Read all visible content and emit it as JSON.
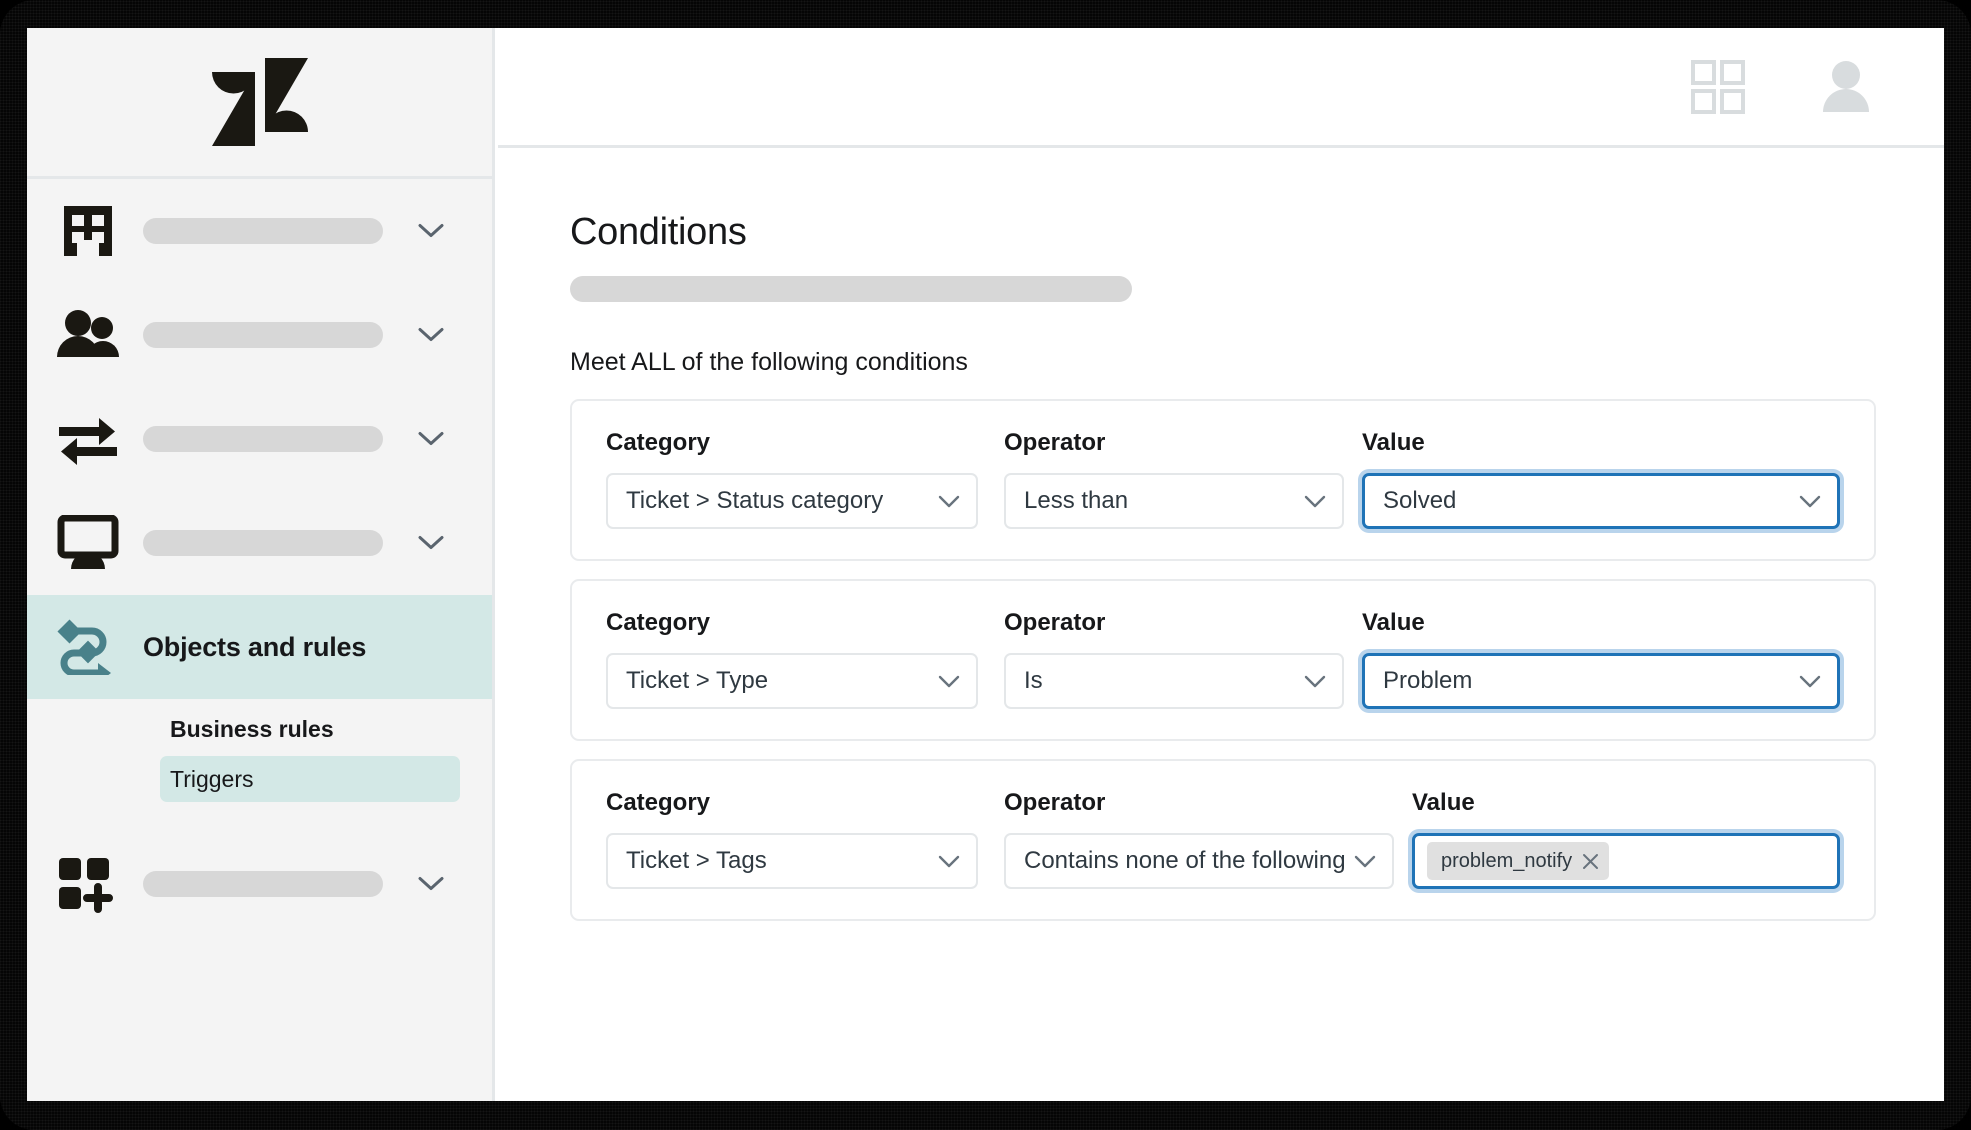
{
  "brand": {
    "logo_name": "zendesk-logo",
    "accent_teal": "#49818a",
    "highlight_teal": "#d3e8e6",
    "focus_blue": "#1f73b7",
    "focus_ring": "#b9d4ec"
  },
  "topbar": {
    "grid_icon": "grid-apps-icon",
    "avatar_icon": "user-avatar-icon"
  },
  "sidebar": {
    "items": [
      {
        "icon": "building-icon",
        "label": "",
        "placeholder": true,
        "chevron": true
      },
      {
        "icon": "people-icon",
        "label": "",
        "placeholder": true,
        "chevron": true
      },
      {
        "icon": "transfer-arrows-icon",
        "label": "",
        "placeholder": true,
        "chevron": true
      },
      {
        "icon": "monitor-icon",
        "label": "",
        "placeholder": true,
        "chevron": true
      },
      {
        "icon": "objects-rules-icon",
        "label": "Objects and rules",
        "placeholder": false,
        "chevron": false,
        "active": true
      },
      {
        "icon": "apps-add-icon",
        "label": "",
        "placeholder": true,
        "chevron": true
      }
    ],
    "subnav": {
      "heading": "Business rules",
      "selected_item": "Triggers"
    }
  },
  "main": {
    "page_title": "Conditions",
    "subtitle_placeholder": true,
    "meet_all_label": "Meet ALL of the following conditions",
    "column_labels": {
      "category": "Category",
      "operator": "Operator",
      "value": "Value"
    },
    "conditions": [
      {
        "category": "Ticket > Status category",
        "operator": "Less than",
        "value": "Solved",
        "value_type": "select",
        "value_focused": true
      },
      {
        "category": "Ticket > Type",
        "operator": "Is",
        "value": "Problem",
        "value_type": "select",
        "value_focused": true
      },
      {
        "category": "Ticket > Tags",
        "operator": "Contains none of the following",
        "value": "problem_notify",
        "value_type": "tags",
        "value_focused": true,
        "tag_remove_icon": "close-icon"
      }
    ]
  }
}
